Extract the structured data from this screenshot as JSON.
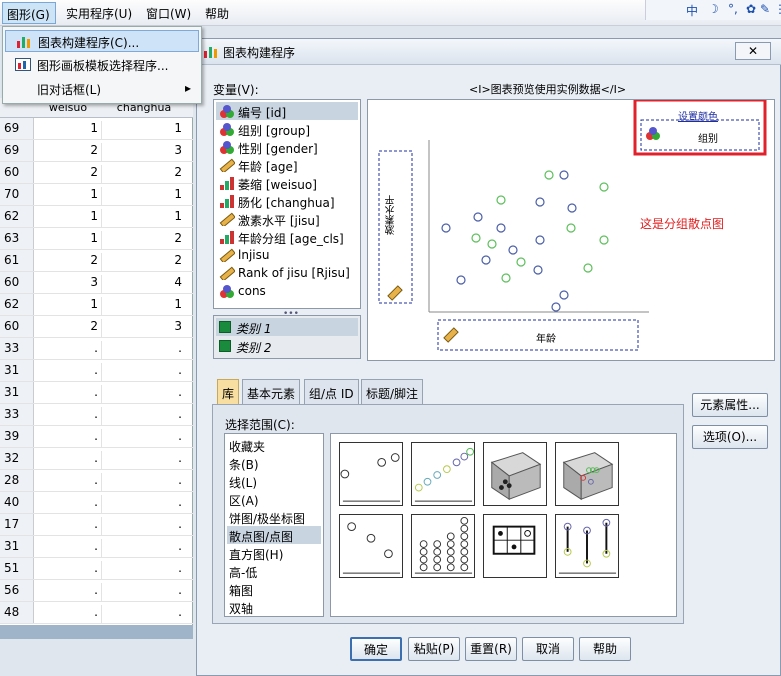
{
  "menubar": {
    "graph": "图形(G)",
    "utilities": "实用程序(U)",
    "window": "窗口(W)",
    "help": "帮助",
    "ime": [
      "中",
      "☽",
      "°,",
      "✿",
      "✎",
      "⋮"
    ]
  },
  "dropdown": {
    "items": [
      {
        "label": "图表构建程序(C)..."
      },
      {
        "label": "图形画板模板选择程序..."
      },
      {
        "label": "旧对话框(L)",
        "arrow": "▸"
      }
    ]
  },
  "grid": {
    "headers": [
      "weisuo",
      "changhua"
    ],
    "rows": [
      [
        "69",
        "1",
        "1"
      ],
      [
        "69",
        "2",
        "3"
      ],
      [
        "60",
        "2",
        "2"
      ],
      [
        "70",
        "1",
        "1"
      ],
      [
        "62",
        "1",
        "1"
      ],
      [
        "63",
        "1",
        "2"
      ],
      [
        "61",
        "2",
        "2"
      ],
      [
        "60",
        "3",
        "4"
      ],
      [
        "62",
        "1",
        "1"
      ],
      [
        "60",
        "2",
        "3"
      ],
      [
        "33",
        ".",
        "."
      ],
      [
        "31",
        ".",
        "."
      ],
      [
        "31",
        ".",
        "."
      ],
      [
        "33",
        ".",
        "."
      ],
      [
        "39",
        ".",
        "."
      ],
      [
        "32",
        ".",
        "."
      ],
      [
        "28",
        ".",
        "."
      ],
      [
        "40",
        ".",
        "."
      ],
      [
        "17",
        ".",
        "."
      ],
      [
        "31",
        ".",
        "."
      ],
      [
        "51",
        ".",
        "."
      ],
      [
        "56",
        ".",
        "."
      ],
      [
        "48",
        ".",
        "."
      ]
    ]
  },
  "dialog": {
    "title": "图表构建程序",
    "close": "✕",
    "variables_label": "变量(V):",
    "variables": [
      {
        "label": "编号 [id]",
        "icon": "nominal-icon"
      },
      {
        "label": "组别 [group]",
        "icon": "nominal-icon"
      },
      {
        "label": "性别 [gender]",
        "icon": "nominal-icon"
      },
      {
        "label": "年龄 [age]",
        "icon": "scale-icon"
      },
      {
        "label": "萎缩 [weisuo]",
        "icon": "ordinal-icon"
      },
      {
        "label": "肠化 [changhua]",
        "icon": "ordinal-icon"
      },
      {
        "label": "激素水平 [jisu]",
        "icon": "scale-icon"
      },
      {
        "label": "年龄分组 [age_cls]",
        "icon": "ordinal-icon"
      },
      {
        "label": "lnjisu",
        "icon": "scale-icon"
      },
      {
        "label": "Rank of jisu [Rjisu]",
        "icon": "scale-icon"
      },
      {
        "label": "cons",
        "icon": "nominal-icon"
      }
    ],
    "categories": [
      "类别 1",
      "类别 2"
    ],
    "preview_note": "<I>图表预览使用实例数据</I>",
    "preview": {
      "set_color": "设置颜色",
      "group_label": "组别",
      "y_label": "激素水平",
      "x_label": "年龄",
      "annotation": "这是分组散点图",
      "annotation_color": "#e02020"
    },
    "tabs": [
      "库",
      "基本元素",
      "组/点 ID",
      "标题/脚注"
    ],
    "select_range_label": "选择范围(C):",
    "chart_types": [
      "收藏夹",
      "条(B)",
      "线(L)",
      "区(A)",
      "饼图/极坐标图",
      "散点图/点图",
      "直方图(H)",
      "高-低",
      "箱图",
      "双轴"
    ],
    "side_buttons": [
      "元素属性...",
      "选项(O)..."
    ],
    "buttons": [
      "确定",
      "粘贴(P)",
      "重置(R)",
      "取消",
      "帮助"
    ]
  }
}
